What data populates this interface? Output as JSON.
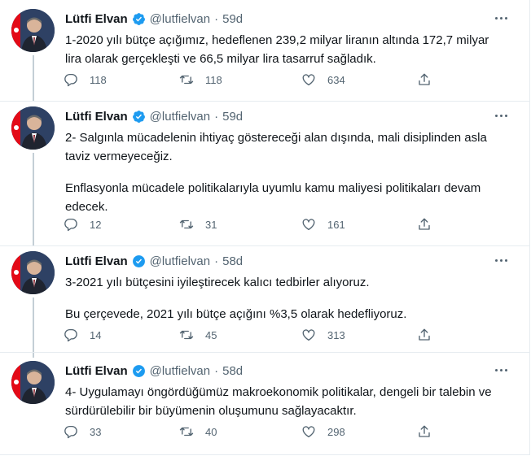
{
  "tweets": [
    {
      "name": "Lütfi Elvan",
      "handle": "@lutfielvan",
      "separator": "·",
      "time": "59d",
      "paragraphs": [
        "1-2020 yılı bütçe açığımız, hedeflenen 239,2 milyar liranın altında 172,7 milyar lira olarak gerçekleşti ve 66,5 milyar lira tasarruf sağladık."
      ],
      "replies": "118",
      "retweets": "118",
      "likes": "634"
    },
    {
      "name": "Lütfi Elvan",
      "handle": "@lutfielvan",
      "separator": "·",
      "time": "59d",
      "paragraphs": [
        "2- Salgınla mücadelenin ihtiyaç göstereceği alan dışında, mali disiplinden asla taviz vermeyeceğiz.",
        "Enflasyonla mücadele politikalarıyla uyumlu kamu maliyesi politikaları devam edecek."
      ],
      "replies": "12",
      "retweets": "31",
      "likes": "161"
    },
    {
      "name": "Lütfi Elvan",
      "handle": "@lutfielvan",
      "separator": "·",
      "time": "58d",
      "paragraphs": [
        "3-2021 yılı bütçesini iyileştirecek kalıcı tedbirler alıyoruz.",
        "Bu çerçevede, 2021 yılı bütçe açığını %3,5 olarak hedefliyoruz."
      ],
      "replies": "14",
      "retweets": "45",
      "likes": "313"
    },
    {
      "name": "Lütfi Elvan",
      "handle": "@lutfielvan",
      "separator": "·",
      "time": "58d",
      "paragraphs": [
        "4- Uygulamayı öngördüğümüz makroekonomik politikalar, dengeli bir talebin ve sürdürülebilir bir büyümenin oluşumunu sağlayacaktır."
      ],
      "replies": "33",
      "retweets": "40",
      "likes": "298"
    }
  ],
  "icons": {
    "reply": "reply-icon",
    "retweet": "retweet-icon",
    "like": "heart-icon",
    "share": "share-icon",
    "verified": "verified-badge-icon",
    "more": "more-icon"
  },
  "colors": {
    "verified": "#1d9bf0",
    "muted": "#536471",
    "text": "#0f1419",
    "flag": "#e30a17",
    "avatar_bg": "#2e4164"
  }
}
